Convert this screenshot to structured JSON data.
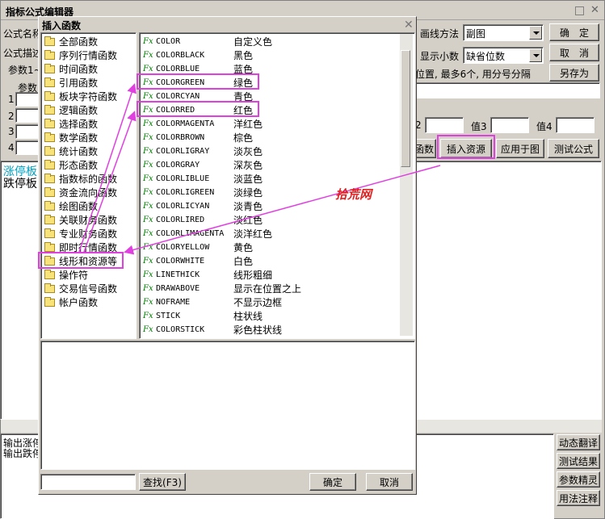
{
  "editor": {
    "title": "指标公式编辑器",
    "formula_name_label": "公式名称",
    "formula_desc_label": "公式描述",
    "params_label": "参数1~",
    "param_col_label": "参数",
    "param_rows": [
      "1",
      "2",
      "3",
      "4"
    ],
    "draw_method_label": "画线方法",
    "draw_method_value": "副图",
    "decimals_label": "显示小数",
    "decimals_value": "缺省位数",
    "position_hint": "位置, 最多6个, 用分号分隔",
    "value_labels": [
      "2",
      "值3",
      "值4"
    ],
    "ok_label": "确　定",
    "cancel_label": "取　消",
    "save_as_label": "另存为",
    "btn_func_label": "函数",
    "btn_insert_resource_label": "插入资源",
    "btn_apply_chart_label": "应用于图",
    "btn_test_formula_label": "测试公式",
    "code_lines": [
      "涨停板",
      "跌停板"
    ],
    "output_lines": [
      "输出涨停",
      "输出跌停"
    ],
    "side_buttons": [
      "动态翻译",
      "测试结果",
      "参数精灵",
      "用法注释"
    ]
  },
  "dialog": {
    "title": "插入函数",
    "categories": [
      "全部函数",
      "序列行情函数",
      "时间函数",
      "引用函数",
      "板块字符函数",
      "逻辑函数",
      "选择函数",
      "数学函数",
      "统计函数",
      "形态函数",
      "指数标的函数",
      "资金流向函数",
      "绘图函数",
      "关联财务函数",
      "专业财务函数",
      "即时行情函数",
      "线形和资源等",
      "操作符",
      "交易信号函数",
      "帐户函数"
    ],
    "fx_glyph": "Fx",
    "functions": [
      {
        "name": "COLOR",
        "desc": "自定义色"
      },
      {
        "name": "COLORBLACK",
        "desc": "黑色"
      },
      {
        "name": "COLORBLUE",
        "desc": "蓝色"
      },
      {
        "name": "COLORGREEN",
        "desc": "绿色"
      },
      {
        "name": "COLORCYAN",
        "desc": "青色"
      },
      {
        "name": "COLORRED",
        "desc": "红色"
      },
      {
        "name": "COLORMAGENTA",
        "desc": "洋红色"
      },
      {
        "name": "COLORBROWN",
        "desc": "棕色"
      },
      {
        "name": "COLORLIGRAY",
        "desc": "淡灰色"
      },
      {
        "name": "COLORGRAY",
        "desc": "深灰色"
      },
      {
        "name": "COLORLIBLUE",
        "desc": "淡蓝色"
      },
      {
        "name": "COLORLIGREEN",
        "desc": "淡绿色"
      },
      {
        "name": "COLORLICYAN",
        "desc": "淡青色"
      },
      {
        "name": "COLORLIRED",
        "desc": "淡红色"
      },
      {
        "name": "COLORLIMAGENTA",
        "desc": "淡洋红色"
      },
      {
        "name": "COLORYELLOW",
        "desc": "黄色"
      },
      {
        "name": "COLORWHITE",
        "desc": "白色"
      },
      {
        "name": "LINETHICK",
        "desc": "线形粗细"
      },
      {
        "name": "DRAWABOVE",
        "desc": "显示在位置之上"
      },
      {
        "name": "NOFRAME",
        "desc": "不显示边框"
      },
      {
        "name": "STICK",
        "desc": "柱状线"
      },
      {
        "name": "COLORSTICK",
        "desc": "彩色柱状线"
      }
    ],
    "search_value": "",
    "find_label": "查找(F3)",
    "ok_label": "确定",
    "cancel_label": "取消",
    "close_glyph": "✕"
  },
  "watermark": "拾荒网",
  "colors": {
    "highlight": "#e040e0",
    "watermark": "#e02020",
    "fx": "#008000",
    "cyan_text": "#00a0c0"
  }
}
